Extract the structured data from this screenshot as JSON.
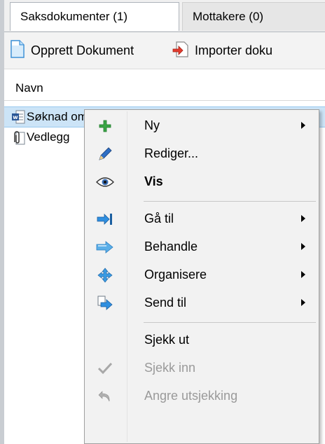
{
  "tabs": [
    {
      "label": "Saksdokumenter (1)",
      "active": true
    },
    {
      "label": "Mottakere (0)",
      "active": false
    }
  ],
  "toolbar": {
    "create_label": "Opprett Dokument",
    "import_label": "Importer doku"
  },
  "list": {
    "header": "Navn",
    "rows": [
      {
        "name": "Søknad om studiefritak",
        "icon": "word-document-icon",
        "selected": true
      },
      {
        "name": "Vedlegg",
        "icon": "paperclip-attachment-icon",
        "selected": false
      }
    ]
  },
  "context_menu": {
    "items": [
      {
        "label": "Ny",
        "icon": "plus-icon",
        "submenu": true
      },
      {
        "label": "Rediger...",
        "icon": "pencil-icon",
        "submenu": false
      },
      {
        "label": "Vis",
        "icon": "eye-icon",
        "submenu": false,
        "bold": true
      },
      {
        "label": "Gå til",
        "icon": "goto-arrow-icon",
        "submenu": true
      },
      {
        "label": "Behandle",
        "icon": "process-arrow-icon",
        "submenu": true
      },
      {
        "label": "Organisere",
        "icon": "move-icon",
        "submenu": true
      },
      {
        "label": "Send til",
        "icon": "send-to-icon",
        "submenu": true
      },
      {
        "label": "Sjekk ut",
        "icon": "",
        "submenu": false
      },
      {
        "label": "Sjekk inn",
        "icon": "checkmark-icon",
        "submenu": false,
        "disabled": true
      },
      {
        "label": "Angre utsjekking",
        "icon": "undo-icon",
        "submenu": false,
        "disabled": true
      }
    ]
  },
  "colors": {
    "selection": "#cce4f7",
    "menu_bg": "#f2f2f2",
    "disabled_text": "#9a9a9a"
  }
}
